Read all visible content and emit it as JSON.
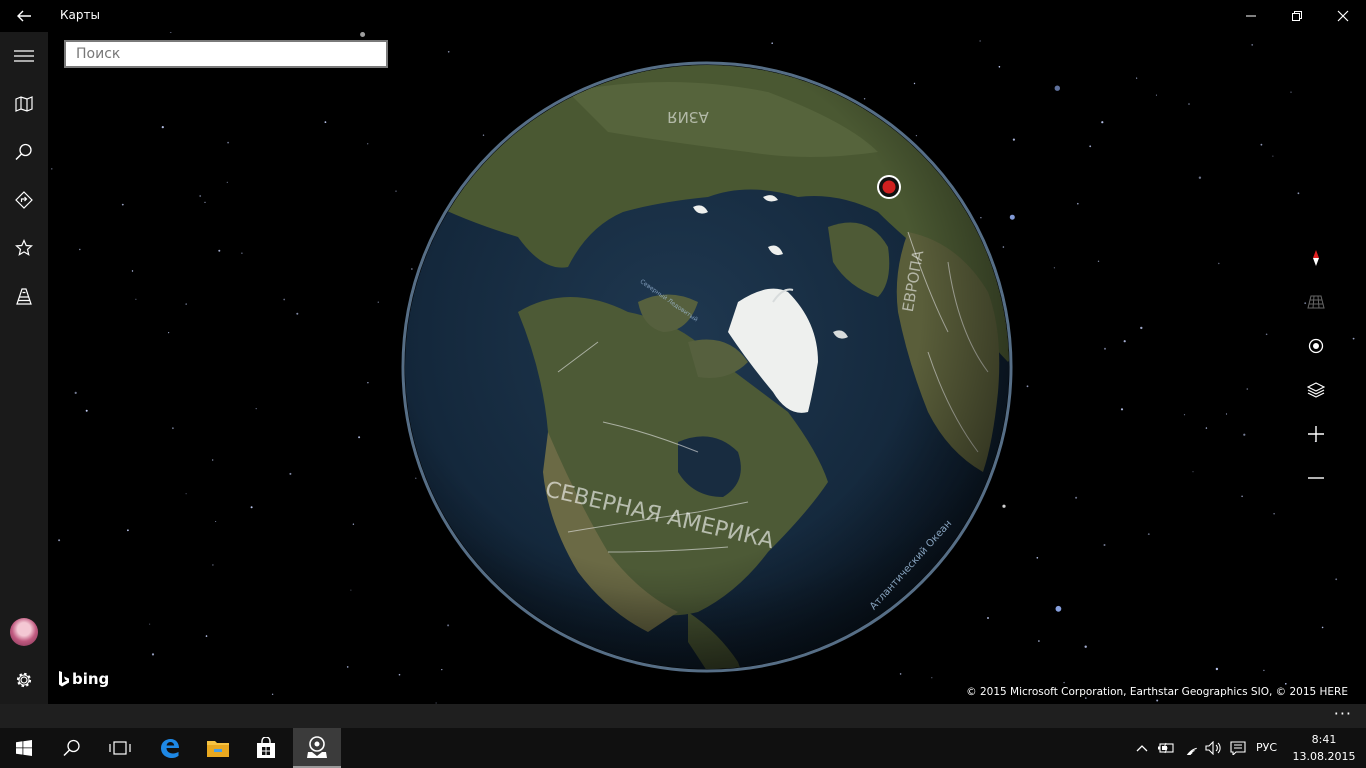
{
  "titlebar": {
    "app_title": "Карты",
    "icons": {
      "back": "back-arrow-icon",
      "minimize": "minimize-icon",
      "restore": "restore-icon",
      "close": "close-icon"
    }
  },
  "sidebar": {
    "items": [
      {
        "name": "menu",
        "icon": "hamburger-menu-icon"
      },
      {
        "name": "map",
        "icon": "map-icon"
      },
      {
        "name": "search",
        "icon": "search-icon"
      },
      {
        "name": "directions",
        "icon": "directions-icon"
      },
      {
        "name": "favorites",
        "icon": "star-icon"
      },
      {
        "name": "3d-cities",
        "icon": "3d-cities-icon"
      },
      {
        "name": "account",
        "icon": "avatar"
      },
      {
        "name": "settings",
        "icon": "gear-icon"
      }
    ]
  },
  "search": {
    "placeholder": "Поиск",
    "value": ""
  },
  "map": {
    "labels": {
      "continent": "СЕВЕРНАЯ АМЕРИКА",
      "ocean_atlantic": "Атлантический Океан",
      "region_europe": "ЕВРОПА",
      "region_top": "АЗИЯ",
      "arctic": "Северный Ледовитый"
    },
    "controls": [
      "compass-icon",
      "tilt-icon",
      "my-location-icon",
      "layers-icon",
      "zoom-in-icon",
      "zoom-out-icon"
    ],
    "brand": "bing",
    "copyright": "© 2015 Microsoft Corporation, Earthstar Geographics  SIO, © 2015 HERE",
    "colors": {
      "ocean": "#15283a",
      "land": "#4d5a35",
      "ice": "#eef0ee",
      "location_pin": "#d02020"
    }
  },
  "appbar": {
    "more": "···"
  },
  "taskbar": {
    "apps": [
      "windows-start-icon",
      "search-icon",
      "task-view-icon",
      "edge-icon",
      "file-explorer-icon",
      "store-icon",
      "maps-icon"
    ],
    "active_app": "maps-icon",
    "tray_icons": [
      "chevron-up-icon",
      "battery-icon",
      "wifi-icon",
      "volume-icon",
      "action-center-icon"
    ],
    "language": "РУС",
    "time": "8:41",
    "date": "13.08.2015"
  }
}
